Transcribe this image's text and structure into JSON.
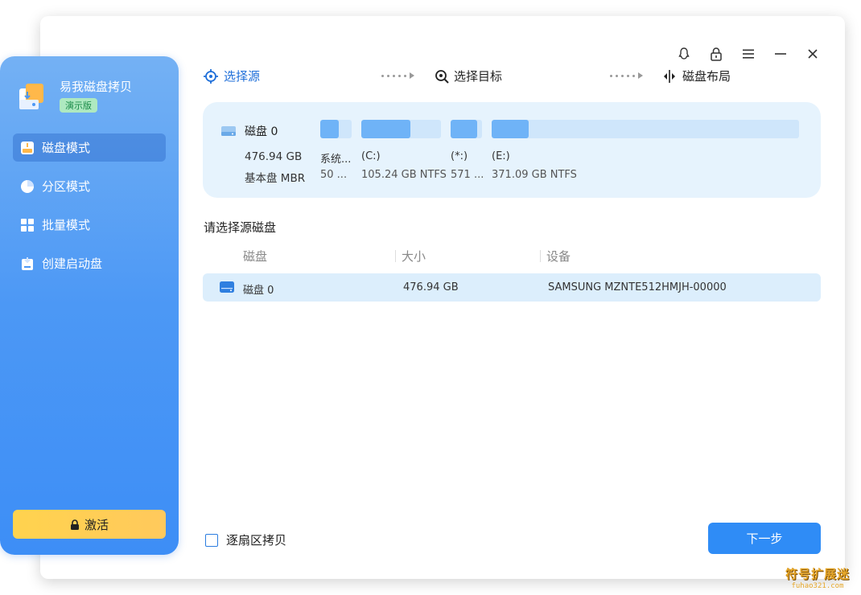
{
  "app": {
    "name": "易我磁盘拷贝",
    "edition_badge": "演示版"
  },
  "colors": {
    "accent": "#2f8cf6",
    "sidebar_top": "#74b1f4",
    "sidebar_bottom": "#3d8ef6",
    "activate": "#ffd34e",
    "card_bg": "#e6f3fd"
  },
  "titlebar": {
    "icons": [
      "feedback-icon",
      "lock-icon",
      "menu-icon",
      "minimize-icon",
      "close-icon"
    ]
  },
  "sidebar": {
    "items": [
      {
        "label": "磁盘模式",
        "icon": "disk-mode-icon",
        "active": true
      },
      {
        "label": "分区模式",
        "icon": "pie-chart-icon",
        "active": false
      },
      {
        "label": "批量模式",
        "icon": "grid-icon",
        "active": false
      },
      {
        "label": "创建启动盘",
        "icon": "boot-disk-icon",
        "active": false
      }
    ],
    "activate_label": "激活"
  },
  "steps": [
    {
      "label": "选择源",
      "icon": "target-icon",
      "active": true
    },
    {
      "label": "选择目标",
      "icon": "search-target-icon",
      "active": false
    },
    {
      "label": "磁盘布局",
      "icon": "layout-icon",
      "active": false
    }
  ],
  "disk_card": {
    "name": "磁盘 0",
    "size": "476.94 GB",
    "type": "基本盘 MBR",
    "partitions": [
      {
        "name": "系统...",
        "info": "50 ...",
        "fill": 0.6
      },
      {
        "name": "(C:)",
        "info": "105.24 GB NTFS",
        "fill": 0.62
      },
      {
        "name": "(*:)",
        "info": "571 ...",
        "fill": 0.85
      },
      {
        "name": "(E:)",
        "info": "371.09 GB NTFS",
        "fill": 0.12
      }
    ]
  },
  "source_section": {
    "title": "请选择源磁盘",
    "columns": [
      "磁盘",
      "大小",
      "设备"
    ],
    "rows": [
      {
        "disk": "磁盘 0",
        "size": "476.94 GB",
        "device": "SAMSUNG MZNTE512HMJH-00000"
      }
    ]
  },
  "footer": {
    "sector_copy_label": "逐扇区拷贝",
    "sector_copy_checked": false,
    "next_label": "下一步"
  },
  "watermark": {
    "main": "符号扩展迷",
    "sub": "fuhao321.com"
  }
}
